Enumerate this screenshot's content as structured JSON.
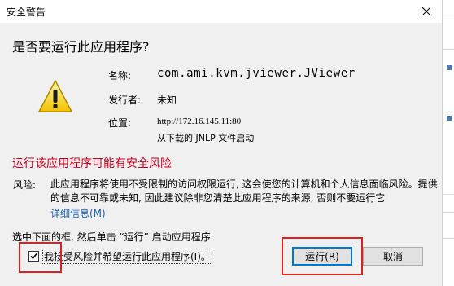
{
  "window": {
    "title": "安全警告"
  },
  "dialog": {
    "heading": "是否要运行此应用程序?",
    "info": {
      "name_label": "名称:",
      "name_value": "com.ami.kvm.jviewer.JViewer",
      "publisher_label": "发行者:",
      "publisher_value": "未知",
      "location_label": "位置:",
      "location_url": "http://172.16.145.11:80",
      "location_note": "从下载的 JNLP 文件启动"
    },
    "risk": {
      "heading": "运行该应用程序可能有安全风险",
      "label": "风险:",
      "text": "此应用程序将使用不受限制的访问权限运行, 这会使您的计算机和个人信息面临风险。提供的信息不可靠或未知, 因此建议除非您清楚此应用程序的来源, 否则不要运行它",
      "details_link": "详细信息(M)"
    },
    "instruction": "选中下面的框, 然后单击 “运行” 启动应用程序",
    "checkbox": {
      "label": "我接受风险并希望运行此应用程序(I)。",
      "checked": true
    },
    "buttons": {
      "run": "运行(R)",
      "cancel": "取消"
    }
  },
  "colors": {
    "risk_heading": "#c8001e",
    "link": "#1a5fb4",
    "highlight": "#e02020",
    "default_button_border": "#0078d7"
  },
  "icons": {
    "warning": "warning-triangle-icon",
    "close": "close-icon",
    "checkmark": "checkmark-icon"
  }
}
